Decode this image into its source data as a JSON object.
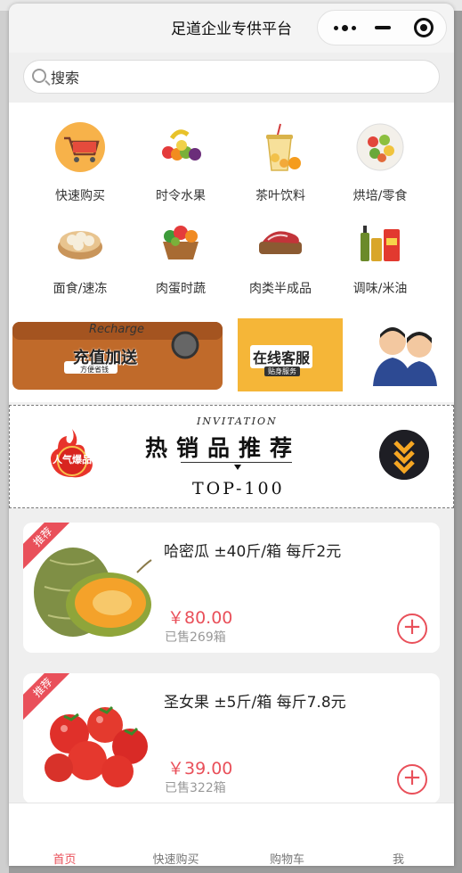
{
  "app": {
    "title": "足道企业专供平台"
  },
  "capsule": {
    "more_icon": "more-dots-icon",
    "minimize_icon": "minimize-icon",
    "close_icon": "target-circle-icon"
  },
  "search": {
    "placeholder": "搜索"
  },
  "categories": [
    {
      "label": "快速购买",
      "icon": "shopping-cart-icon"
    },
    {
      "label": "时令水果",
      "icon": "fruit-icon"
    },
    {
      "label": "茶叶饮料",
      "icon": "bubble-tea-icon"
    },
    {
      "label": "烘培/零食",
      "icon": "salad-bowl-icon"
    },
    {
      "label": "面食/速冻",
      "icon": "dumpling-steamer-icon"
    },
    {
      "label": "肉蛋时蔬",
      "icon": "vegetable-basket-icon"
    },
    {
      "label": "肉类半成品",
      "icon": "raw-meat-icon"
    },
    {
      "label": "调味/米油",
      "icon": "condiment-bottles-icon"
    }
  ],
  "banners": {
    "recharge": {
      "en": "Recharge",
      "title": "充值加送",
      "sub": "方便省钱"
    },
    "service": {
      "title": "在线客服",
      "sub": "贴身服务"
    },
    "cs_icon": "customer-service-avatars-icon"
  },
  "hot": {
    "label": "INVITATION",
    "title": "热销品推荐",
    "sub": "TOP-100",
    "badge": "人气爆品"
  },
  "products": [
    {
      "ribbon": "推荐",
      "name": "哈密瓜 ±40斤/箱 每斤2元",
      "price": "￥80.00",
      "sold": "已售269箱",
      "image": "hami-melon-image"
    },
    {
      "ribbon": "推荐",
      "name": "圣女果 ±5斤/箱 每斤7.8元",
      "price": "￥39.00",
      "sold": "已售322箱",
      "image": "cherry-tomato-image"
    }
  ],
  "tabbar": [
    {
      "label": "首页",
      "active": true
    },
    {
      "label": "快速购买",
      "active": false
    },
    {
      "label": "购物车",
      "active": false
    },
    {
      "label": "我",
      "active": false
    }
  ],
  "colors": {
    "accent": "#e9505a",
    "service_yellow": "#f5b638"
  }
}
